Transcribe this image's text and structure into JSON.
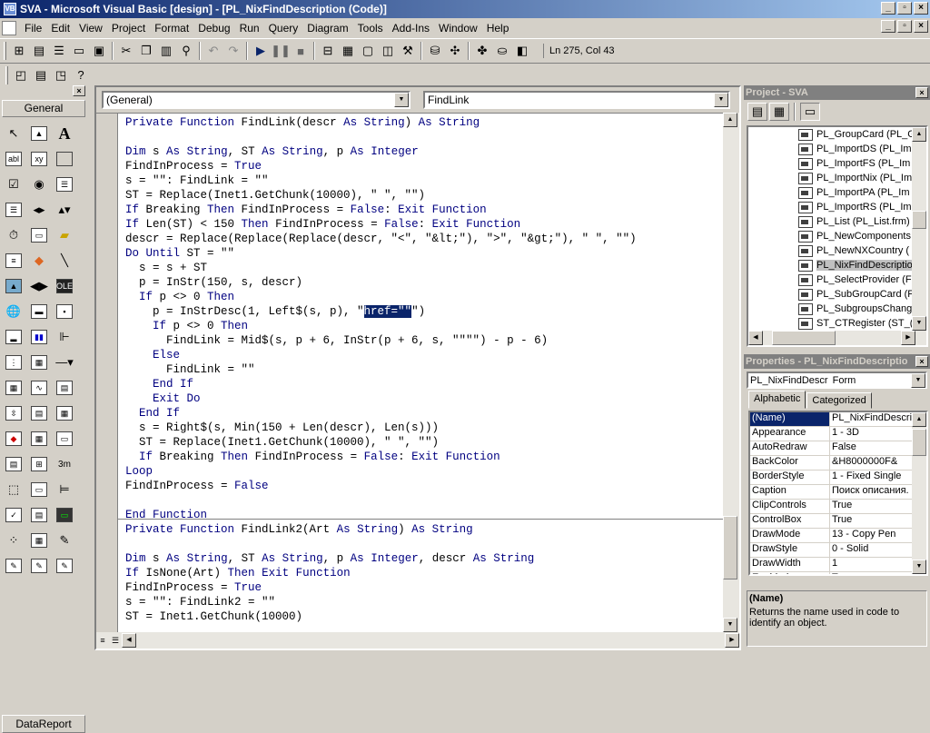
{
  "app": {
    "title": "SVA - Microsoft Visual Basic [design] - [PL_NixFindDescription (Code)]"
  },
  "menu": [
    "File",
    "Edit",
    "View",
    "Project",
    "Format",
    "Debug",
    "Run",
    "Query",
    "Diagram",
    "Tools",
    "Add-Ins",
    "Window",
    "Help"
  ],
  "toolbar": {
    "position": "Ln 275, Col 43"
  },
  "toolbox": {
    "tab_label": "General",
    "bottom_label": "DataReport"
  },
  "code_window": {
    "object_combo": "(General)",
    "proc_combo": "FindLink",
    "lines": [
      "Private Function FindLink(descr As String) As String",
      "",
      "Dim s As String, ST As String, p As Integer",
      "FindInProcess = True",
      "s = \"\": FindLink = \"\"",
      "ST = Replace(Inet1.GetChunk(10000), \" \", \"\")",
      "If Breaking Then FindInProcess = False: Exit Function",
      "If Len(ST) < 150 Then FindInProcess = False: Exit Function",
      "descr = Replace(Replace(Replace(descr, \"<\", \"&lt;\"), \">\", \"&gt;\"), \" \", \"\")",
      "Do Until ST = \"\"",
      "  s = s + ST",
      "  p = InStr(150, s, descr)",
      "  If p <> 0 Then",
      "    p = InStrDesc(1, Left$(s, p), \"href=\"\"\")",
      "    If p <> 0 Then",
      "      FindLink = Mid$(s, p + 6, InStr(p + 6, s, \"\"\"\") - p - 6)",
      "    Else",
      "      FindLink = \"\"",
      "    End If",
      "    Exit Do",
      "  End If",
      "  s = Right$(s, Min(150 + Len(descr), Len(s)))",
      "  ST = Replace(Inet1.GetChunk(10000), \" \", \"\")",
      "  If Breaking Then FindInProcess = False: Exit Function",
      "Loop",
      "FindInProcess = False",
      "",
      "End Function",
      "Private Function FindLink2(Art As String) As String",
      "",
      "Dim s As String, ST As String, p As Integer, descr As String",
      "If IsNone(Art) Then Exit Function",
      "FindInProcess = True",
      "s = \"\": FindLink2 = \"\"",
      "ST = Inet1.GetChunk(10000)"
    ],
    "selected_text": "href=\"\""
  },
  "project": {
    "title": "Project - SVA",
    "items": [
      {
        "label": "PL_GroupCard (PL_G",
        "selected": false
      },
      {
        "label": "PL_ImportDS (PL_Im",
        "selected": false
      },
      {
        "label": "PL_ImportFS (PL_Im",
        "selected": false
      },
      {
        "label": "PL_ImportNix (PL_Im",
        "selected": false
      },
      {
        "label": "PL_ImportPA (PL_Im",
        "selected": false
      },
      {
        "label": "PL_ImportRS (PL_Im",
        "selected": false
      },
      {
        "label": "PL_List (PL_List.frm)",
        "selected": false
      },
      {
        "label": "PL_NewComponents",
        "selected": false
      },
      {
        "label": "PL_NewNXCountry (",
        "selected": false
      },
      {
        "label": "PL_NixFindDescriptio",
        "selected": true
      },
      {
        "label": "PL_SelectProvider (F",
        "selected": false
      },
      {
        "label": "PL_SubGroupCard (F",
        "selected": false
      },
      {
        "label": "PL_SubgroupsChang",
        "selected": false
      },
      {
        "label": "ST_CTRegister (ST_(",
        "selected": false
      }
    ]
  },
  "properties": {
    "title": "Properties - PL_NixFindDescriptio",
    "object": "PL_NixFindDescr",
    "object_type": "Form",
    "tabs": [
      "Alphabetic",
      "Categorized"
    ],
    "rows": [
      {
        "name": "(Name)",
        "value": "PL_NixFindDescrip"
      },
      {
        "name": "Appearance",
        "value": "1 - 3D"
      },
      {
        "name": "AutoRedraw",
        "value": "False"
      },
      {
        "name": "BackColor",
        "value": "&H8000000F&"
      },
      {
        "name": "BorderStyle",
        "value": "1 - Fixed Single"
      },
      {
        "name": "Caption",
        "value": "Поиск описания."
      },
      {
        "name": "ClipControls",
        "value": "True"
      },
      {
        "name": "ControlBox",
        "value": "True"
      },
      {
        "name": "DrawMode",
        "value": "13 - Copy Pen"
      },
      {
        "name": "DrawStyle",
        "value": "0 - Solid"
      },
      {
        "name": "DrawWidth",
        "value": "1"
      },
      {
        "name": "Enabled",
        "value": "True"
      }
    ],
    "desc_title": "(Name)",
    "desc_text": "Returns the name used in code to identify an object."
  }
}
